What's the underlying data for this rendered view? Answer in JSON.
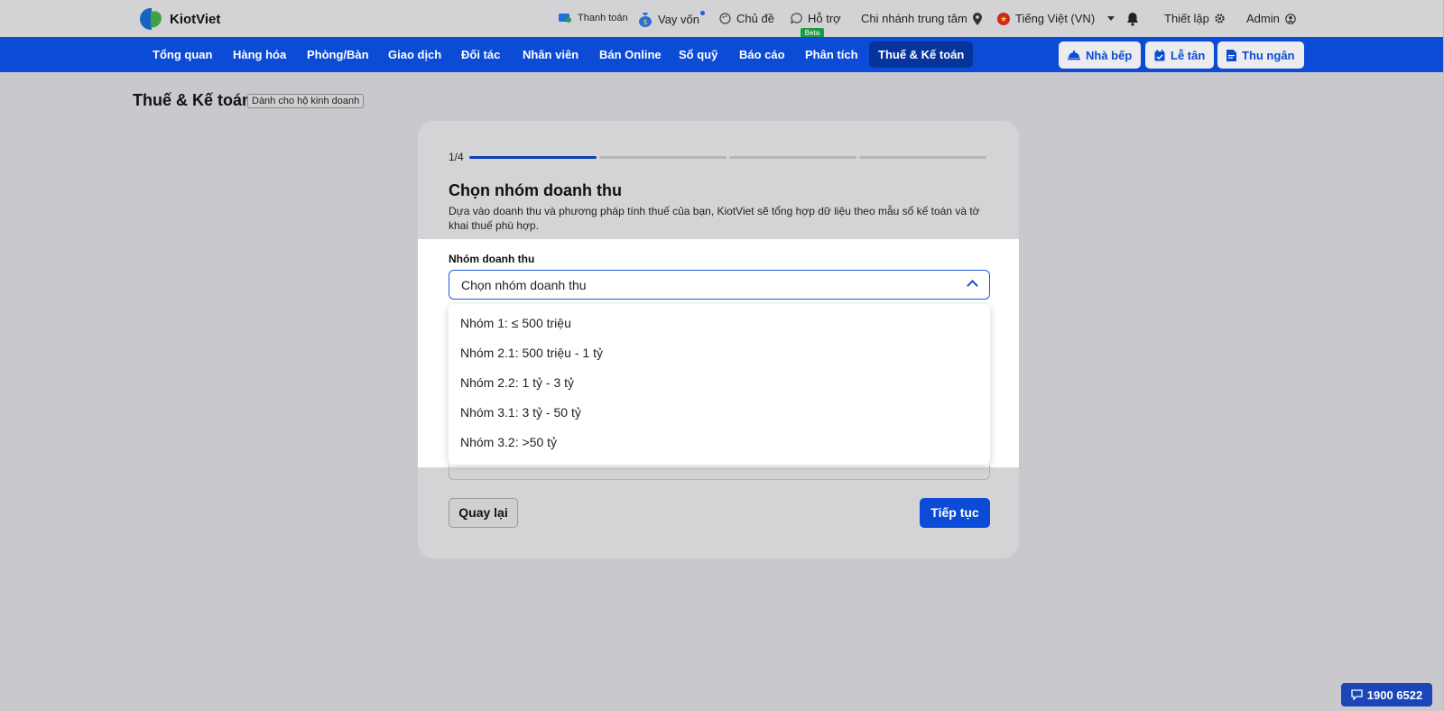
{
  "brand": {
    "name": "KiotViet"
  },
  "topbar": {
    "payment": "Thanh toán",
    "loan": "Vay vốn",
    "theme": "Chủ đề",
    "support": "Hỗ trợ",
    "support_badge": "Beta",
    "branch": "Chi nhánh trung tâm",
    "language": "Tiếng Việt (VN)",
    "settings": "Thiết lập",
    "user": "Admin"
  },
  "nav": {
    "items": [
      "Tổng quan",
      "Hàng hóa",
      "Phòng/Bàn",
      "Giao dịch",
      "Đối tác",
      "Nhân viên",
      "Bán Online",
      "Sổ quỹ",
      "Báo cáo",
      "Phân tích",
      "Thuế & Kế toán"
    ],
    "active": "Thuế & Kế toán",
    "kitchen": "Nhà bếp",
    "reception": "Lễ tân",
    "cashier": "Thu ngân"
  },
  "page": {
    "title": "Thuế & Kế toán",
    "badge": "Dành cho hộ kinh doanh"
  },
  "wizard": {
    "step": "1/4",
    "progress": 0.25,
    "title": "Chọn nhóm doanh thu",
    "description": "Dựa vào doanh thu và phương pháp tính thuế của bạn, KiotViet sẽ tổng hợp dữ liệu theo mẫu sổ kế toán và tờ khai thuế phù hợp.",
    "field_label": "Nhóm doanh thu",
    "select_placeholder": "Chọn nhóm doanh thu",
    "options": [
      "Nhóm 1: ≤ 500 triệu",
      "Nhóm 2.1: 500 triệu - 1 tỷ",
      "Nhóm 2.2: 1 tỷ - 3 tỷ",
      "Nhóm 3.1: 3 tỷ - 50 tỷ",
      "Nhóm 3.2: >50 tỷ"
    ],
    "back_label": "Quay lại",
    "next_label": "Tiếp tục"
  },
  "hotline": "1900 6522",
  "colors": {
    "primary": "#0b4bd6",
    "active_nav": "#06349a",
    "beta": "#1d9b42"
  }
}
